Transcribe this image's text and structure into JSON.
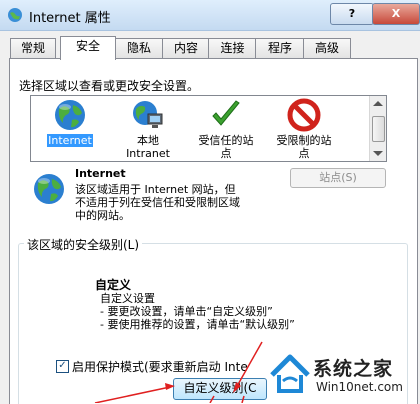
{
  "window": {
    "title": "Internet 属性",
    "help_label": "?",
    "close_label": "X"
  },
  "tabs": [
    {
      "label": "常规",
      "active": false
    },
    {
      "label": "安全",
      "active": true
    },
    {
      "label": "隐私",
      "active": false
    },
    {
      "label": "内容",
      "active": false
    },
    {
      "label": "连接",
      "active": false
    },
    {
      "label": "程序",
      "active": false
    },
    {
      "label": "高级",
      "active": false
    }
  ],
  "security": {
    "instruction": "选择区域以查看或更改安全设置。",
    "zones": [
      {
        "label_line1": "Internet",
        "label_line2": "",
        "icon": "globe-icon",
        "selected": true
      },
      {
        "label_line1": "本地",
        "label_line2": "Intranet",
        "icon": "intranet-icon",
        "selected": false
      },
      {
        "label_line1": "受信任的站",
        "label_line2": "点",
        "icon": "checkmark-icon",
        "selected": false
      },
      {
        "label_line1": "受限制的站",
        "label_line2": "点",
        "icon": "restricted-icon",
        "selected": false
      }
    ],
    "zone_info": {
      "title": "Internet",
      "desc_line1": "该区域适用于 Internet 网站，但",
      "desc_line2": "不适用于列在受信任和受限制区域",
      "desc_line3": "中的网站。"
    },
    "sites_button": "站点(S)",
    "level_group_label": "该区域的安全级别(L)",
    "level_title": "自定义",
    "level_desc_line1": "自定义设置",
    "level_desc_line2": "- 要更改设置，请单击“自定义级别”",
    "level_desc_line3": "- 要使用推荐的设置，请单击“默认级别”",
    "protected_mode_label": "启用保护模式(要求重新启动 Inte",
    "protected_mode_checked": "✓",
    "custom_level_button": "自定义级别(C"
  },
  "watermark": {
    "name": "系统之家",
    "url": "Win10net.com"
  },
  "colors": {
    "selection": "#3399ff",
    "arrow": "#e02020"
  }
}
